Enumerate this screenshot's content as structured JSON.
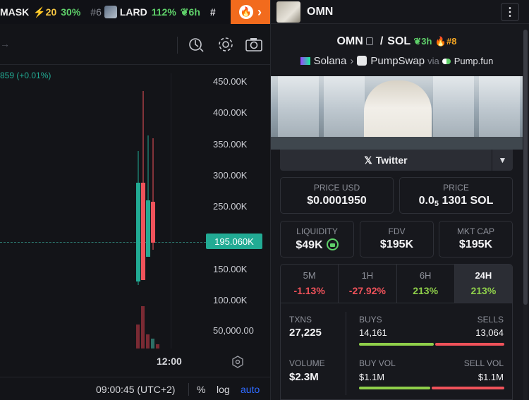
{
  "ticker": {
    "items": [
      {
        "symbol": "MASK",
        "boost": "⚡20",
        "change": "30%"
      },
      {
        "rank": "#6",
        "symbol": "LARD",
        "change": "112%",
        "age": "6h"
      }
    ],
    "trailing_hash": "#"
  },
  "chart": {
    "price_change": "859 (+0.01%)",
    "y_axis": [
      "450.00K",
      "400.00K",
      "350.00K",
      "300.00K",
      "250.00K",
      "150.00K",
      "100.00K",
      "50,000.00"
    ],
    "current_price": "195.060K",
    "time_label": "12:00",
    "clock": "09:00:45 (UTC+2)",
    "pct_label": "%",
    "log_label": "log",
    "auto_label": "auto",
    "accent": "#22ab94"
  },
  "token": {
    "name": "OMN",
    "base": "OMN",
    "quote": "SOL",
    "age": "3h",
    "rank": "#8",
    "chain": "Solana",
    "dex": "PumpSwap",
    "via": "via",
    "launchpad": "Pump.fun",
    "twitter_label": "Twitter"
  },
  "price": {
    "usd_label": "PRICE USD",
    "usd_value": "$0.0001950",
    "native_label": "PRICE",
    "native_prefix": "0.0",
    "native_sub": "5",
    "native_rest": "1301 SOL"
  },
  "metrics": {
    "liquidity_label": "LIQUIDITY",
    "liquidity": "$49K",
    "fdv_label": "FDV",
    "fdv": "$195K",
    "mcap_label": "MKT CAP",
    "mcap": "$195K"
  },
  "timeframes": [
    {
      "label": "5M",
      "value": "-1.13%"
    },
    {
      "label": "1H",
      "value": "-27.92%"
    },
    {
      "label": "6H",
      "value": "213%"
    },
    {
      "label": "24H",
      "value": "213%"
    }
  ],
  "stats": {
    "txns_label": "TXNS",
    "txns": "27,225",
    "buys_label": "BUYS",
    "buys": "14,161",
    "sells_label": "SELLS",
    "sells": "13,064",
    "volume_label": "VOLUME",
    "volume": "$2.3M",
    "buyvol_label": "BUY VOL",
    "buyvol": "$1.1M",
    "sellvol_label": "SELL VOL",
    "sellvol": "$1.1M",
    "buy_color": "#8fcf4a",
    "sell_color": "#f0525a"
  }
}
